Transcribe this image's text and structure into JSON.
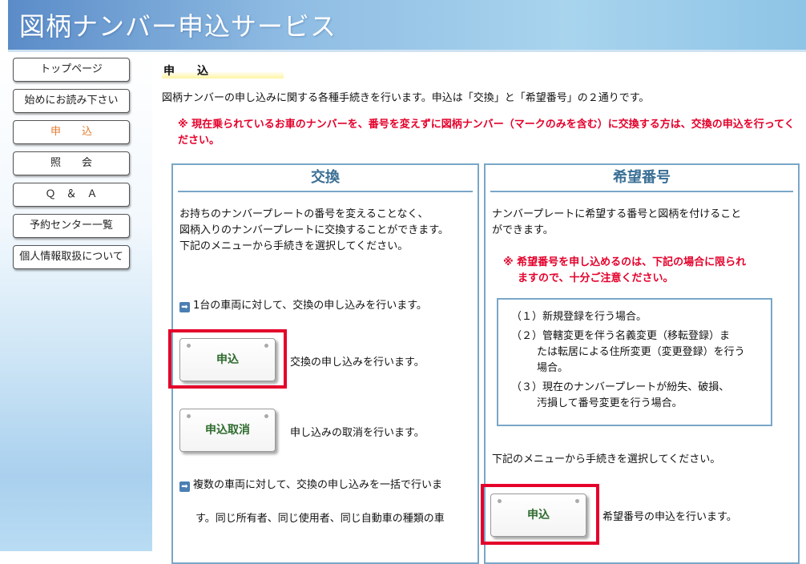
{
  "header": {
    "title": "図柄ナンバー申込サービス"
  },
  "nav": [
    {
      "label": "トップページ",
      "active": false
    },
    {
      "label": "始めにお読み下さい",
      "active": false
    },
    {
      "label": "申　　込",
      "active": true
    },
    {
      "label": "照　　会",
      "active": false
    },
    {
      "label": "Ｑ　＆　Ａ",
      "active": false
    },
    {
      "label": "予約センター一覧",
      "active": false
    },
    {
      "label": "個人情報取扱について",
      "active": false
    }
  ],
  "main": {
    "heading": "申　　込",
    "intro": "図柄ナンバーの申し込みに関する各種手続きを行います。申込は「交換」と「希望番号」の２通りです。",
    "notice_mark": "※",
    "notice": "現在乗られているお車のナンバーを、番号を変えずに図柄ナンバー（マークのみを含む）に交換する方は、交換の申込を行ってください。"
  },
  "exchange": {
    "title": "交換",
    "desc1": "お持ちのナンバープレートの番号を変えることなく、",
    "desc2": "図柄入りのナンバープレートに交換することができます。",
    "desc3": "下記のメニューから手続きを選択してください。",
    "single_text": "1台の車両に対して、交換の申し込みを行います。",
    "apply_button": "申込",
    "apply_desc": "交換の申し込みを行います。",
    "cancel_button": "申込取消",
    "cancel_desc": "申し込みの取消を行います。",
    "multi_text1": "複数の車両に対して、交換の申し込みを一括で行いま",
    "multi_text2": "す。同じ所有者、同じ使用者、同じ自動車の種類の車"
  },
  "hope": {
    "title": "希望番号",
    "desc1": "ナンバープレートに希望する番号と図柄を付けること",
    "desc2": "ができます。",
    "notice_mark": "※",
    "notice1": "希望番号を申し込めるのは、下記の場合に限られ",
    "notice2": "ますので、十分ご注意ください。",
    "cond1": "（１）新規登録を行う場合。",
    "cond2a": "（２）管轄変更を伴う名義変更（移転登録）ま",
    "cond2b": "たは転居による住所変更（変更登録）を行う",
    "cond2c": "場合。",
    "cond3a": "（３）現在のナンバープレートが紛失、破損、",
    "cond3b": "汚損して番号変更を行う場合。",
    "menu_text": "下記のメニューから手続きを選択してください。",
    "apply_button": "申込",
    "apply_desc": "希望番号の申込を行います。"
  },
  "colors": {
    "accent_red": "#e4002b",
    "panel_border": "#7aa7c8",
    "active_nav": "#e57a2e"
  }
}
